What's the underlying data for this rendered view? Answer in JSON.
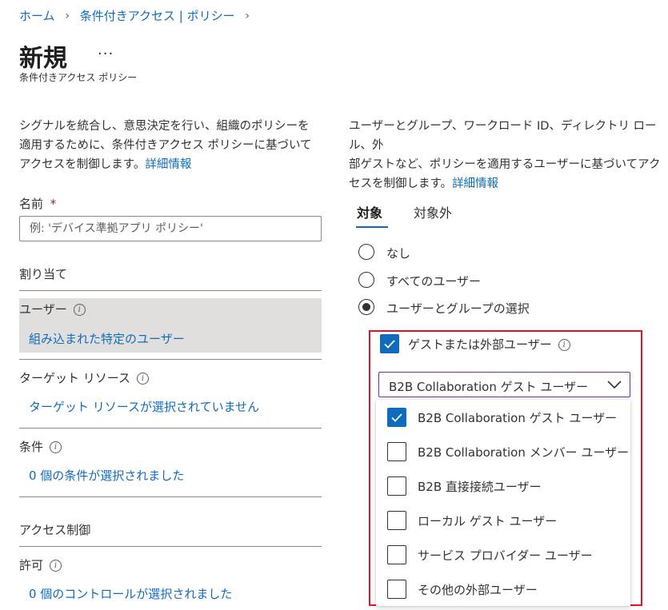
{
  "breadcrumb": {
    "home": "ホーム",
    "policies": "条件付きアクセス | ポリシー"
  },
  "page": {
    "title": "新規",
    "more": "...",
    "subtitle": "条件付きアクセス ポリシー"
  },
  "left": {
    "desc_line1": "シグナルを統合し、意思決定を行い、組織のポリシーを",
    "desc_line2": "適用するために、条件付きアクセス ポリシーに基づいて",
    "desc_line3": "アクセスを制御します。",
    "learn_more": "詳細情報",
    "name_label": "名前",
    "required_mark": "*",
    "name_placeholder": "例: 'デバイス準拠アプリ ポリシー'",
    "assignments": "割り当て",
    "users_label": "ユーザー",
    "users_value": "組み込まれた特定のユーザー",
    "target_label": "ターゲット リソース",
    "target_value": "ターゲット リソースが選択されていません",
    "conditions_label": "条件",
    "conditions_value": "0 個の条件が選択されました",
    "access_controls": "アクセス制御",
    "grant_label": "許可",
    "grant_value": "0 個のコントロールが選択されました"
  },
  "right": {
    "desc_line1": "ユーザーとグループ、ワークロード ID、ディレクトリ ロール、外",
    "desc_line2": "部ゲストなど、ポリシーを適用するユーザーに基づいてアク",
    "desc_line3": "セスを制御します。",
    "learn_more": "詳細情報",
    "tabs": [
      {
        "label": "対象",
        "active": true
      },
      {
        "label": "対象外",
        "active": false
      }
    ],
    "radios": [
      {
        "label": "なし",
        "selected": false
      },
      {
        "label": "すべてのユーザー",
        "selected": false
      },
      {
        "label": "ユーザーとグループの選択",
        "selected": true
      }
    ],
    "guest_checkbox": {
      "label": "ゲストまたは外部ユーザー",
      "checked": true
    },
    "dropdown_value": "B2B Collaboration ゲスト ユーザー",
    "options": [
      {
        "label": "B2B Collaboration ゲスト ユーザー",
        "checked": true
      },
      {
        "label": "B2B Collaboration メンバー ユーザー",
        "checked": false
      },
      {
        "label": "B2B 直接接続ユーザー",
        "checked": false
      },
      {
        "label": "ローカル ゲスト ユーザー",
        "checked": false
      },
      {
        "label": "サービス プロバイダー ユーザー",
        "checked": false
      },
      {
        "label": "その他の外部ユーザー",
        "checked": false
      }
    ]
  },
  "colors": {
    "accent": "#0f6cbd",
    "highlight_border": "#e81123",
    "required": "#a4262c",
    "selected_row_bg": "#e1dfdd"
  },
  "icons": [
    "chevron-right-icon",
    "info-icon",
    "checkmark-icon",
    "chevron-down-icon"
  ]
}
